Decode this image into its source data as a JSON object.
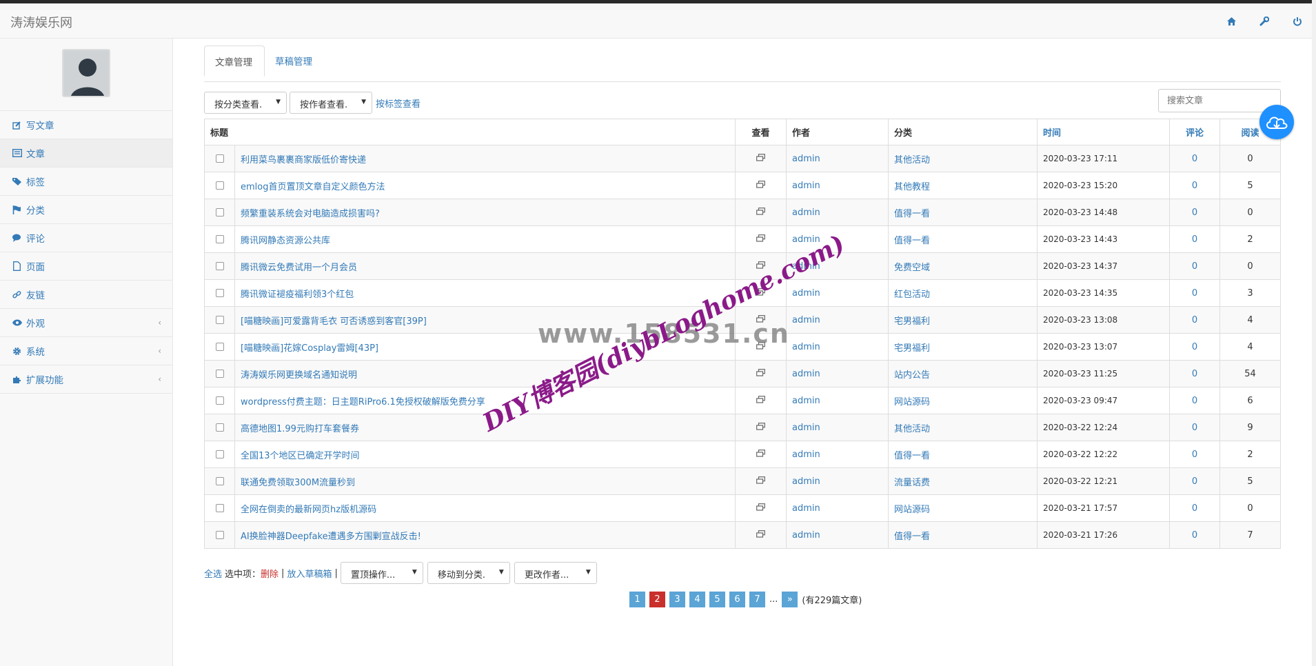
{
  "app": {
    "brand": "涛涛娱乐网"
  },
  "sidebar": {
    "items": [
      {
        "label": "写文章",
        "icon": "edit-icon"
      },
      {
        "label": "文章",
        "icon": "list-icon"
      },
      {
        "label": "标签",
        "icon": "tags-icon"
      },
      {
        "label": "分类",
        "icon": "flag-icon"
      },
      {
        "label": "评论",
        "icon": "comments-icon"
      },
      {
        "label": "页面",
        "icon": "file-icon"
      },
      {
        "label": "友链",
        "icon": "link-icon"
      },
      {
        "label": "外观",
        "icon": "eye-icon",
        "arrow": "‹"
      },
      {
        "label": "系统",
        "icon": "gear-icon",
        "arrow": "‹"
      },
      {
        "label": "扩展功能",
        "icon": "puzzle-icon",
        "arrow": "‹"
      }
    ]
  },
  "tabs": {
    "articles": "文章管理",
    "drafts": "草稿管理"
  },
  "filters": {
    "by_category": "按分类查看.",
    "by_author": "按作者查看.",
    "by_tag": "按标签查看",
    "search_placeholder": "搜索文章"
  },
  "table": {
    "headers": {
      "title": "标题",
      "view": "查看",
      "author": "作者",
      "category": "分类",
      "time": "时间",
      "comments": "评论",
      "reads": "阅读"
    },
    "rows": [
      {
        "title": "利用菜鸟裹裹商家版低价寄快递",
        "author": "admin",
        "category": "其他活动",
        "time": "2020-03-23 17:11",
        "comments": "0",
        "reads": "0"
      },
      {
        "title": "emlog首页置顶文章自定义颜色方法",
        "author": "admin",
        "category": "其他教程",
        "time": "2020-03-23 15:20",
        "comments": "0",
        "reads": "5"
      },
      {
        "title": "频繁重装系统会对电脑造成损害吗?",
        "author": "admin",
        "category": "值得一看",
        "time": "2020-03-23 14:48",
        "comments": "0",
        "reads": "0"
      },
      {
        "title": "腾讯网静态资源公共库",
        "author": "admin",
        "category": "值得一看",
        "time": "2020-03-23 14:43",
        "comments": "0",
        "reads": "2"
      },
      {
        "title": "腾讯微云免费试用一个月会员",
        "author": "admin",
        "category": "免费空域",
        "time": "2020-03-23 14:37",
        "comments": "0",
        "reads": "0"
      },
      {
        "title": "腾讯微证褪疫福利领3个红包",
        "author": "admin",
        "category": "红包活动",
        "time": "2020-03-23 14:35",
        "comments": "0",
        "reads": "3"
      },
      {
        "title": "[喵糖映画]可爱露背毛衣 可否诱惑到客官[39P]",
        "author": "admin",
        "category": "宅男福利",
        "time": "2020-03-23 13:08",
        "comments": "0",
        "reads": "4"
      },
      {
        "title": "[喵糖映画]花嫁Cosplay雷姆[43P]",
        "author": "admin",
        "category": "宅男福利",
        "time": "2020-03-23 13:07",
        "comments": "0",
        "reads": "4"
      },
      {
        "title": "涛涛娱乐网更换域名通知说明",
        "author": "admin",
        "category": "站内公告",
        "time": "2020-03-23 11:25",
        "comments": "0",
        "reads": "54"
      },
      {
        "title": "wordpress付费主题：日主题RiPro6.1免授权破解版免费分享",
        "author": "admin",
        "category": "网站源码",
        "time": "2020-03-23 09:47",
        "comments": "0",
        "reads": "6"
      },
      {
        "title": "高德地图1.99元购打车套餐券",
        "author": "admin",
        "category": "其他活动",
        "time": "2020-03-22 12:24",
        "comments": "0",
        "reads": "9"
      },
      {
        "title": "全国13个地区已确定开学时间",
        "author": "admin",
        "category": "值得一看",
        "time": "2020-03-22 12:22",
        "comments": "0",
        "reads": "2"
      },
      {
        "title": "联通免费领取300M流量秒到",
        "author": "admin",
        "category": "流量话费",
        "time": "2020-03-22 12:21",
        "comments": "0",
        "reads": "5"
      },
      {
        "title": "全网在倒卖的最新网页hz版机源码",
        "author": "admin",
        "category": "网站源码",
        "time": "2020-03-21 17:57",
        "comments": "0",
        "reads": "0"
      },
      {
        "title": "AI换脸神器Deepfake遭遇多方围剿宣战反击!",
        "author": "admin",
        "category": "值得一看",
        "time": "2020-03-21 17:26",
        "comments": "0",
        "reads": "7"
      }
    ]
  },
  "bulk": {
    "select_all": "全选",
    "selected_label": "选中项：",
    "delete": "删除",
    "sep1": "|",
    "to_draft": "放入草稿箱",
    "sep2": "|",
    "pin": "置顶操作...",
    "move": "移动到分类.",
    "change_author": "更改作者..."
  },
  "pagination": {
    "pages": [
      "1",
      "2",
      "3",
      "4",
      "5",
      "6",
      "7"
    ],
    "current": "2",
    "ellipsis": "...",
    "next": "»",
    "total": "(有229篇文章)"
  },
  "watermark": {
    "gray": "www.158531.cn",
    "purple": "DIY博客园(diybLoghome.com)"
  },
  "colors": {
    "link": "#337ab7",
    "danger": "#c9302c",
    "page": "#5ba4d6",
    "watermark": "#8b1a89",
    "cloud": "#1e90ff"
  }
}
